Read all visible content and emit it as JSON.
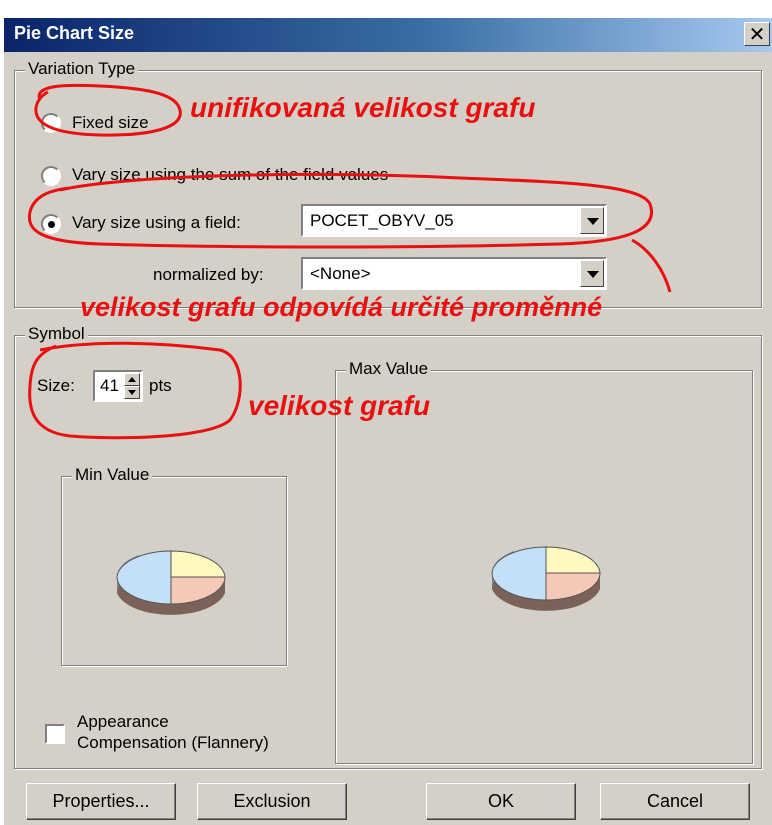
{
  "dialog": {
    "title": "Pie Chart Size",
    "close_glyph": "✕"
  },
  "variation": {
    "legend": "Variation Type",
    "fixed_label": "Fixed size",
    "sum_label": "Vary size using the sum of the field values",
    "field_label": "Vary size using a field:",
    "field_value": "POCET_OBYV_05",
    "normalized_label": "normalized by:",
    "normalized_value": "<None>",
    "selected": "field"
  },
  "symbol": {
    "legend": "Symbol",
    "size_label": "Size:",
    "size_value": "41",
    "size_unit": "pts",
    "min_legend": "Min Value",
    "max_legend": "Max Value",
    "appearance_label_1": "Appearance",
    "appearance_label_2": "Compensation (Flannery)",
    "appearance_checked": false
  },
  "annotations": {
    "fixed": "unifikovaná velikost grafu",
    "field": "velikost grafu odpovídá určité proměnné",
    "size": "velikost grafu"
  },
  "buttons": {
    "properties": "Properties...",
    "exclusion": "Exclusion",
    "ok": "OK",
    "cancel": "Cancel"
  },
  "colors": {
    "pie_yellow": "#fff8c0",
    "pie_pink": "#f6c8b8",
    "pie_blue": "#c4e0f8",
    "annotation": "#e81010"
  }
}
